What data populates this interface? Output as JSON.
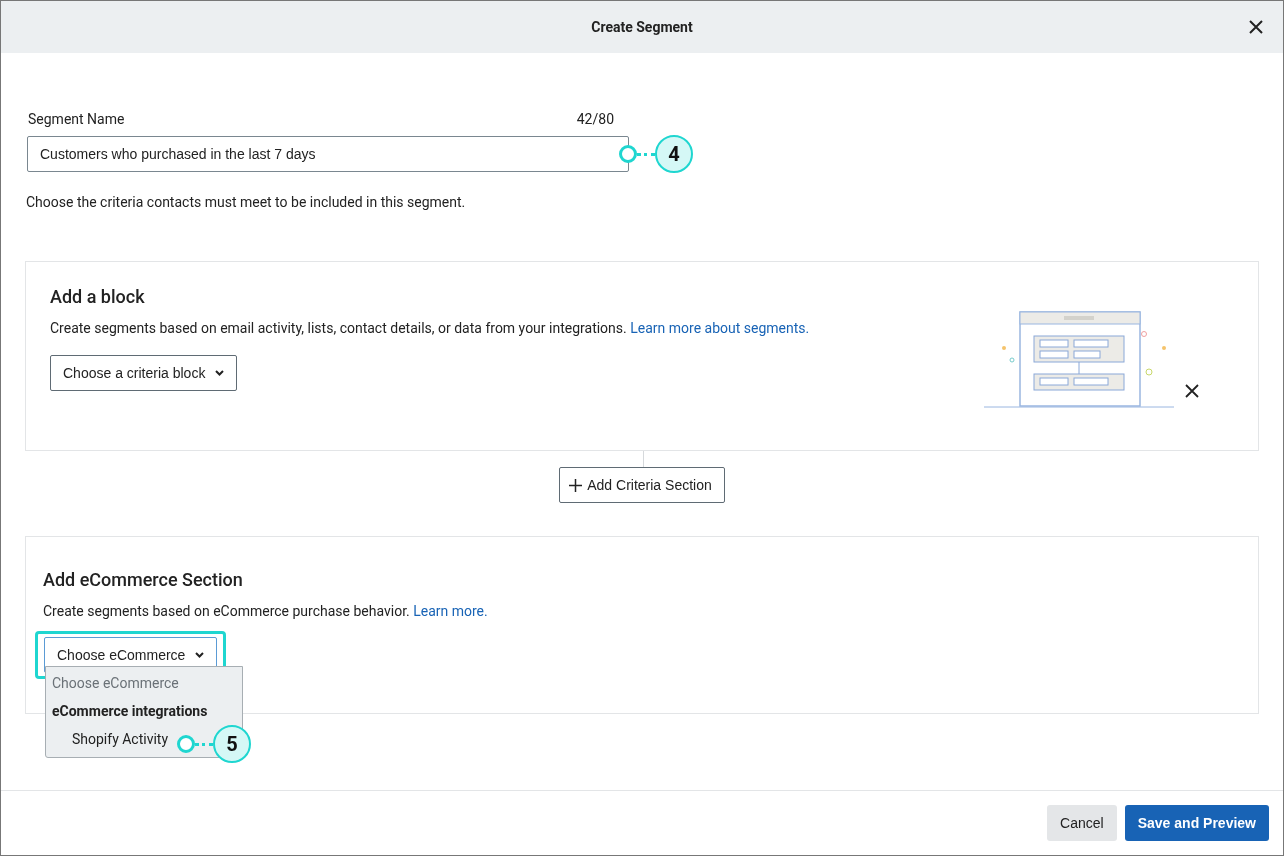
{
  "dialog": {
    "title": "Create Segment"
  },
  "segment_name": {
    "label": "Segment Name",
    "counter": "42/80",
    "value": "Customers who purchased in the last 7 days"
  },
  "instructions": "Choose the criteria contacts must meet to be included in this segment.",
  "block_section": {
    "title": "Add a block",
    "description": "Create segments based on email activity, lists, contact details, or data from your integrations.",
    "link": "Learn more about segments.",
    "select": "Choose a criteria block"
  },
  "add_section_button": "Add Criteria Section",
  "ecommerce_section": {
    "title": "Add eCommerce Section",
    "description": "Create segments based on eCommerce purchase behavior.",
    "link": "Learn more.",
    "select": "Choose eCommerce",
    "dropdown": [
      {
        "kind": "placeholder",
        "label": "Choose eCommerce"
      },
      {
        "kind": "group",
        "label": "eCommerce integrations"
      },
      {
        "kind": "option",
        "label": "Shopify Activity"
      }
    ]
  },
  "callouts": [
    {
      "label": "4"
    },
    {
      "label": "5"
    }
  ],
  "buttons": [
    {
      "kind": "secondary",
      "label": "Cancel"
    },
    {
      "kind": "primary",
      "label": "Save and Preview"
    }
  ]
}
